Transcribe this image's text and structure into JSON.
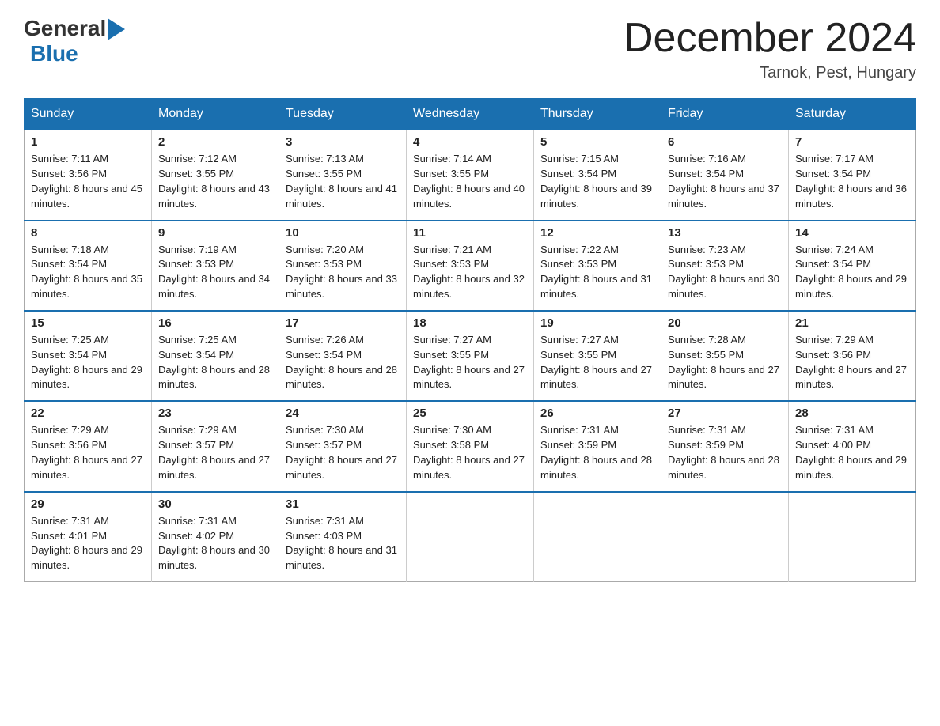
{
  "header": {
    "logo_general": "General",
    "logo_blue": "Blue",
    "title": "December 2024",
    "location": "Tarnok, Pest, Hungary"
  },
  "weekdays": [
    "Sunday",
    "Monday",
    "Tuesday",
    "Wednesday",
    "Thursday",
    "Friday",
    "Saturday"
  ],
  "weeks": [
    [
      {
        "day": "1",
        "sunrise": "7:11 AM",
        "sunset": "3:56 PM",
        "daylight": "8 hours and 45 minutes."
      },
      {
        "day": "2",
        "sunrise": "7:12 AM",
        "sunset": "3:55 PM",
        "daylight": "8 hours and 43 minutes."
      },
      {
        "day": "3",
        "sunrise": "7:13 AM",
        "sunset": "3:55 PM",
        "daylight": "8 hours and 41 minutes."
      },
      {
        "day": "4",
        "sunrise": "7:14 AM",
        "sunset": "3:55 PM",
        "daylight": "8 hours and 40 minutes."
      },
      {
        "day": "5",
        "sunrise": "7:15 AM",
        "sunset": "3:54 PM",
        "daylight": "8 hours and 39 minutes."
      },
      {
        "day": "6",
        "sunrise": "7:16 AM",
        "sunset": "3:54 PM",
        "daylight": "8 hours and 37 minutes."
      },
      {
        "day": "7",
        "sunrise": "7:17 AM",
        "sunset": "3:54 PM",
        "daylight": "8 hours and 36 minutes."
      }
    ],
    [
      {
        "day": "8",
        "sunrise": "7:18 AM",
        "sunset": "3:54 PM",
        "daylight": "8 hours and 35 minutes."
      },
      {
        "day": "9",
        "sunrise": "7:19 AM",
        "sunset": "3:53 PM",
        "daylight": "8 hours and 34 minutes."
      },
      {
        "day": "10",
        "sunrise": "7:20 AM",
        "sunset": "3:53 PM",
        "daylight": "8 hours and 33 minutes."
      },
      {
        "day": "11",
        "sunrise": "7:21 AM",
        "sunset": "3:53 PM",
        "daylight": "8 hours and 32 minutes."
      },
      {
        "day": "12",
        "sunrise": "7:22 AM",
        "sunset": "3:53 PM",
        "daylight": "8 hours and 31 minutes."
      },
      {
        "day": "13",
        "sunrise": "7:23 AM",
        "sunset": "3:53 PM",
        "daylight": "8 hours and 30 minutes."
      },
      {
        "day": "14",
        "sunrise": "7:24 AM",
        "sunset": "3:54 PM",
        "daylight": "8 hours and 29 minutes."
      }
    ],
    [
      {
        "day": "15",
        "sunrise": "7:25 AM",
        "sunset": "3:54 PM",
        "daylight": "8 hours and 29 minutes."
      },
      {
        "day": "16",
        "sunrise": "7:25 AM",
        "sunset": "3:54 PM",
        "daylight": "8 hours and 28 minutes."
      },
      {
        "day": "17",
        "sunrise": "7:26 AM",
        "sunset": "3:54 PM",
        "daylight": "8 hours and 28 minutes."
      },
      {
        "day": "18",
        "sunrise": "7:27 AM",
        "sunset": "3:55 PM",
        "daylight": "8 hours and 27 minutes."
      },
      {
        "day": "19",
        "sunrise": "7:27 AM",
        "sunset": "3:55 PM",
        "daylight": "8 hours and 27 minutes."
      },
      {
        "day": "20",
        "sunrise": "7:28 AM",
        "sunset": "3:55 PM",
        "daylight": "8 hours and 27 minutes."
      },
      {
        "day": "21",
        "sunrise": "7:29 AM",
        "sunset": "3:56 PM",
        "daylight": "8 hours and 27 minutes."
      }
    ],
    [
      {
        "day": "22",
        "sunrise": "7:29 AM",
        "sunset": "3:56 PM",
        "daylight": "8 hours and 27 minutes."
      },
      {
        "day": "23",
        "sunrise": "7:29 AM",
        "sunset": "3:57 PM",
        "daylight": "8 hours and 27 minutes."
      },
      {
        "day": "24",
        "sunrise": "7:30 AM",
        "sunset": "3:57 PM",
        "daylight": "8 hours and 27 minutes."
      },
      {
        "day": "25",
        "sunrise": "7:30 AM",
        "sunset": "3:58 PM",
        "daylight": "8 hours and 27 minutes."
      },
      {
        "day": "26",
        "sunrise": "7:31 AM",
        "sunset": "3:59 PM",
        "daylight": "8 hours and 28 minutes."
      },
      {
        "day": "27",
        "sunrise": "7:31 AM",
        "sunset": "3:59 PM",
        "daylight": "8 hours and 28 minutes."
      },
      {
        "day": "28",
        "sunrise": "7:31 AM",
        "sunset": "4:00 PM",
        "daylight": "8 hours and 29 minutes."
      }
    ],
    [
      {
        "day": "29",
        "sunrise": "7:31 AM",
        "sunset": "4:01 PM",
        "daylight": "8 hours and 29 minutes."
      },
      {
        "day": "30",
        "sunrise": "7:31 AM",
        "sunset": "4:02 PM",
        "daylight": "8 hours and 30 minutes."
      },
      {
        "day": "31",
        "sunrise": "7:31 AM",
        "sunset": "4:03 PM",
        "daylight": "8 hours and 31 minutes."
      },
      null,
      null,
      null,
      null
    ]
  ],
  "labels": {
    "sunrise_prefix": "Sunrise: ",
    "sunset_prefix": "Sunset: ",
    "daylight_prefix": "Daylight: "
  }
}
